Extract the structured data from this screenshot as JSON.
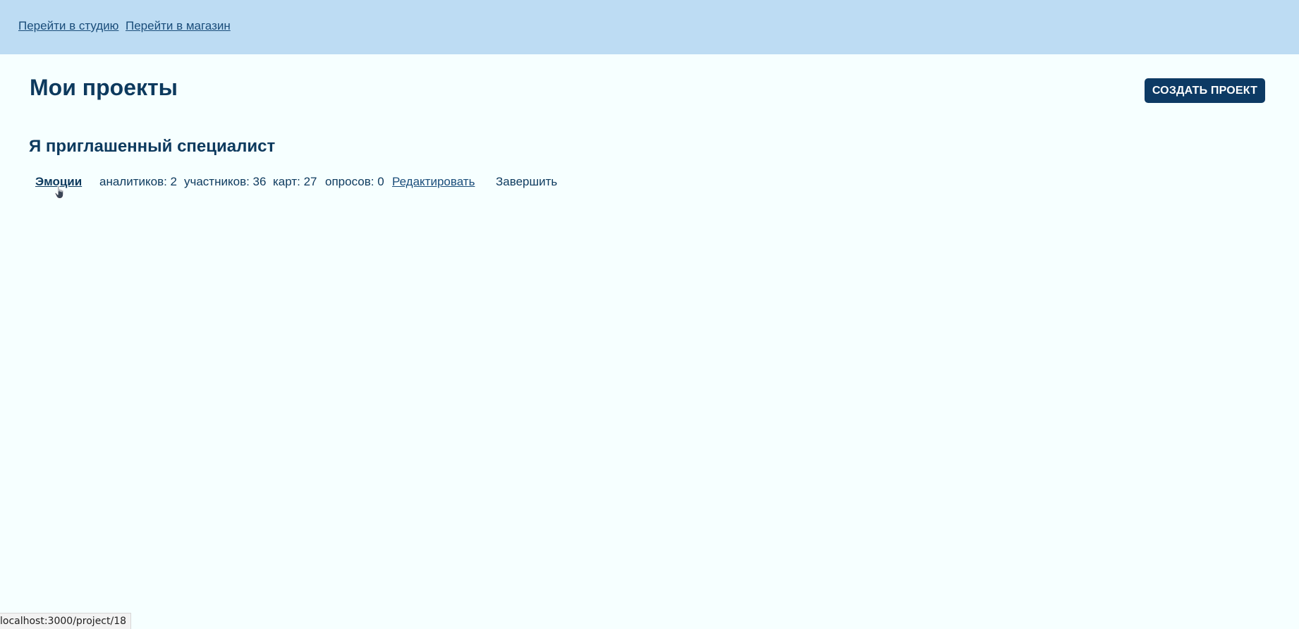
{
  "nav": {
    "studio_link": "Перейти в студию",
    "shop_link": "Перейти в магазин"
  },
  "page": {
    "title": "Мои проекты",
    "create_button": "СОЗДАТЬ ПРОЕКТ"
  },
  "section": {
    "title": "Я приглашенный специалист",
    "projects": [
      {
        "name": "Эмоции",
        "analysts": "аналитиков: 2",
        "participants": "участников: 36",
        "cards": "карт: 27",
        "surveys": "опросов: 0",
        "edit_label": "Редактировать",
        "finish_label": "Завершить"
      }
    ]
  },
  "status_bar": {
    "url": "localhost:3000/project/18"
  },
  "icons": {
    "cursor": "hand-pointer-icon"
  },
  "colors": {
    "header_bg": "#bddcf3",
    "page_bg": "#f6ffff",
    "primary": "#0d3a64",
    "text": "#0d3a5e"
  }
}
